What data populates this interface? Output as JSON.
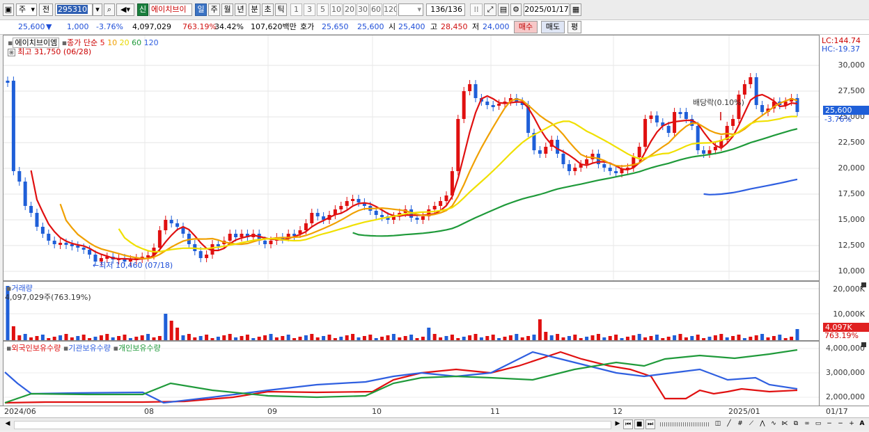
{
  "toolbar": {
    "market": "주",
    "prev": "전",
    "code": "295310",
    "search_icon": "magnifier-icon",
    "speaker_icon": "speaker-icon",
    "new_badge": "신",
    "stock_name": "에이치브이",
    "periods": [
      "일",
      "주",
      "월",
      "년",
      "분",
      "초",
      "틱"
    ],
    "active_period": "일",
    "nums": [
      "1",
      "3",
      "5",
      "10",
      "20",
      "30",
      "60",
      "120"
    ],
    "count": "136/136",
    "date": "2025/01/17"
  },
  "quote": {
    "price": "25,600",
    "arrow": "▼",
    "change": "1,000",
    "change_rate": "-3.76%",
    "volume": "4,097,029",
    "vol_rate": "763.19%",
    "turnover": "34.42%",
    "amount": "107,620백만",
    "hoga_label": "호가",
    "ask": "25,650",
    "bid": "25,600",
    "open_label": "시",
    "open": "25,400",
    "high_label": "고",
    "high": "28,450",
    "low_label": "저",
    "low": "24,000",
    "buy": "매수",
    "sell": "매도",
    "eval": "평"
  },
  "main_panel": {
    "name": "에이치브이엠",
    "ma_label": "종가 단순",
    "ma_periods": [
      "5",
      "10",
      "20",
      "60",
      "120"
    ],
    "ma_colors": [
      "#e01010",
      "#f0a000",
      "#f0e000",
      "#1f9a3a",
      "#2f5fe0"
    ],
    "high_note": "최고 31,750 (06/28)",
    "low_note": "최저 10,460 (07/18)",
    "dividend_note": "배당락(0.10%)",
    "lc": "LC:144.74",
    "hc": "HC:-19.37",
    "y_ticks": [
      "30,000",
      "27,500",
      "25,000",
      "22,500",
      "20,000",
      "17,500",
      "15,000",
      "12,500",
      "10,000"
    ],
    "last_price": "25,600",
    "last_rate": "-3.76%"
  },
  "volume_panel": {
    "title": "거래량",
    "value": "4,097,029주(763.19%)",
    "y_ticks": [
      "20,000K",
      "10,000K"
    ],
    "last": "4,097K",
    "last_rate": "763.19%"
  },
  "holding_panel": {
    "legend": [
      "외국인보유수량",
      "기관보유수량",
      "개인보유수량"
    ],
    "colors": [
      "#e01010",
      "#2f5fe0",
      "#1f9a3a"
    ],
    "y_ticks": [
      "4,000,000",
      "3,000,000",
      "2,000,000"
    ]
  },
  "dates": [
    "2024/06",
    "08",
    "09",
    "10",
    "11",
    "12",
    "2025/01",
    "01/17"
  ]
}
